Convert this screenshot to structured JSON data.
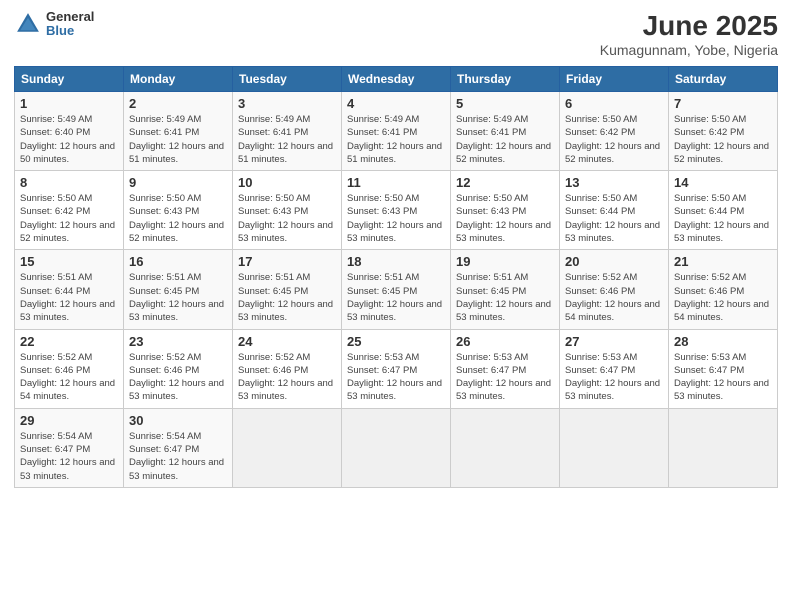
{
  "logo": {
    "general": "General",
    "blue": "Blue"
  },
  "title": {
    "month": "June 2025",
    "location": "Kumagunnam, Yobe, Nigeria"
  },
  "headers": [
    "Sunday",
    "Monday",
    "Tuesday",
    "Wednesday",
    "Thursday",
    "Friday",
    "Saturday"
  ],
  "weeks": [
    [
      {
        "day": "1",
        "sunrise": "5:49 AM",
        "sunset": "6:40 PM",
        "daylight": "12 hours and 50 minutes."
      },
      {
        "day": "2",
        "sunrise": "5:49 AM",
        "sunset": "6:41 PM",
        "daylight": "12 hours and 51 minutes."
      },
      {
        "day": "3",
        "sunrise": "5:49 AM",
        "sunset": "6:41 PM",
        "daylight": "12 hours and 51 minutes."
      },
      {
        "day": "4",
        "sunrise": "5:49 AM",
        "sunset": "6:41 PM",
        "daylight": "12 hours and 51 minutes."
      },
      {
        "day": "5",
        "sunrise": "5:49 AM",
        "sunset": "6:41 PM",
        "daylight": "12 hours and 52 minutes."
      },
      {
        "day": "6",
        "sunrise": "5:50 AM",
        "sunset": "6:42 PM",
        "daylight": "12 hours and 52 minutes."
      },
      {
        "day": "7",
        "sunrise": "5:50 AM",
        "sunset": "6:42 PM",
        "daylight": "12 hours and 52 minutes."
      }
    ],
    [
      {
        "day": "8",
        "sunrise": "5:50 AM",
        "sunset": "6:42 PM",
        "daylight": "12 hours and 52 minutes."
      },
      {
        "day": "9",
        "sunrise": "5:50 AM",
        "sunset": "6:43 PM",
        "daylight": "12 hours and 52 minutes."
      },
      {
        "day": "10",
        "sunrise": "5:50 AM",
        "sunset": "6:43 PM",
        "daylight": "12 hours and 53 minutes."
      },
      {
        "day": "11",
        "sunrise": "5:50 AM",
        "sunset": "6:43 PM",
        "daylight": "12 hours and 53 minutes."
      },
      {
        "day": "12",
        "sunrise": "5:50 AM",
        "sunset": "6:43 PM",
        "daylight": "12 hours and 53 minutes."
      },
      {
        "day": "13",
        "sunrise": "5:50 AM",
        "sunset": "6:44 PM",
        "daylight": "12 hours and 53 minutes."
      },
      {
        "day": "14",
        "sunrise": "5:50 AM",
        "sunset": "6:44 PM",
        "daylight": "12 hours and 53 minutes."
      }
    ],
    [
      {
        "day": "15",
        "sunrise": "5:51 AM",
        "sunset": "6:44 PM",
        "daylight": "12 hours and 53 minutes."
      },
      {
        "day": "16",
        "sunrise": "5:51 AM",
        "sunset": "6:45 PM",
        "daylight": "12 hours and 53 minutes."
      },
      {
        "day": "17",
        "sunrise": "5:51 AM",
        "sunset": "6:45 PM",
        "daylight": "12 hours and 53 minutes."
      },
      {
        "day": "18",
        "sunrise": "5:51 AM",
        "sunset": "6:45 PM",
        "daylight": "12 hours and 53 minutes."
      },
      {
        "day": "19",
        "sunrise": "5:51 AM",
        "sunset": "6:45 PM",
        "daylight": "12 hours and 53 minutes."
      },
      {
        "day": "20",
        "sunrise": "5:52 AM",
        "sunset": "6:46 PM",
        "daylight": "12 hours and 54 minutes."
      },
      {
        "day": "21",
        "sunrise": "5:52 AM",
        "sunset": "6:46 PM",
        "daylight": "12 hours and 54 minutes."
      }
    ],
    [
      {
        "day": "22",
        "sunrise": "5:52 AM",
        "sunset": "6:46 PM",
        "daylight": "12 hours and 54 minutes."
      },
      {
        "day": "23",
        "sunrise": "5:52 AM",
        "sunset": "6:46 PM",
        "daylight": "12 hours and 53 minutes."
      },
      {
        "day": "24",
        "sunrise": "5:52 AM",
        "sunset": "6:46 PM",
        "daylight": "12 hours and 53 minutes."
      },
      {
        "day": "25",
        "sunrise": "5:53 AM",
        "sunset": "6:47 PM",
        "daylight": "12 hours and 53 minutes."
      },
      {
        "day": "26",
        "sunrise": "5:53 AM",
        "sunset": "6:47 PM",
        "daylight": "12 hours and 53 minutes."
      },
      {
        "day": "27",
        "sunrise": "5:53 AM",
        "sunset": "6:47 PM",
        "daylight": "12 hours and 53 minutes."
      },
      {
        "day": "28",
        "sunrise": "5:53 AM",
        "sunset": "6:47 PM",
        "daylight": "12 hours and 53 minutes."
      }
    ],
    [
      {
        "day": "29",
        "sunrise": "5:54 AM",
        "sunset": "6:47 PM",
        "daylight": "12 hours and 53 minutes."
      },
      {
        "day": "30",
        "sunrise": "5:54 AM",
        "sunset": "6:47 PM",
        "daylight": "12 hours and 53 minutes."
      },
      null,
      null,
      null,
      null,
      null
    ]
  ]
}
